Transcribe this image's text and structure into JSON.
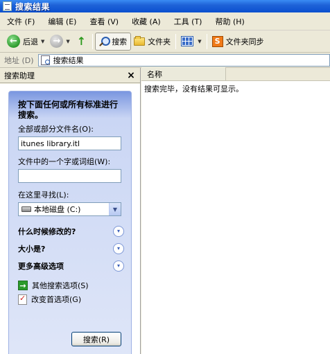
{
  "window": {
    "title": "搜索结果"
  },
  "menu": {
    "items": [
      {
        "label": "文件 (F)"
      },
      {
        "label": "编辑 (E)"
      },
      {
        "label": "查看 (V)"
      },
      {
        "label": "收藏 (A)"
      },
      {
        "label": "工具 (T)"
      },
      {
        "label": "帮助 (H)"
      }
    ]
  },
  "toolbar": {
    "back_label": "后退",
    "search_label": "搜索",
    "folders_label": "文件夹",
    "sync_label": "文件夹同步"
  },
  "address": {
    "label": "地址 (D)",
    "value": "搜索结果"
  },
  "left_pane": {
    "title": "搜索助理",
    "close_glyph": "×",
    "prompt": "按下面任何或所有标准进行搜索。",
    "filename_label": "全部或部分文件名(O):",
    "filename_value": "itunes library.itl",
    "phrase_label": "文件中的一个字或词组(W):",
    "phrase_value": "",
    "lookin_label": "在这里寻找(L):",
    "lookin_value": "本地磁盘 (C:)",
    "expanders": [
      {
        "label": "什么时候修改的?"
      },
      {
        "label": "大小是?"
      },
      {
        "label": "更多高级选项"
      }
    ],
    "links": {
      "other_options": "其他搜索选项(S)",
      "change_prefs": "改变首选项(G)"
    },
    "search_button": "搜索(R)"
  },
  "results": {
    "column_name": "名称",
    "empty_message": "搜索完毕，没有结果可显示。"
  }
}
